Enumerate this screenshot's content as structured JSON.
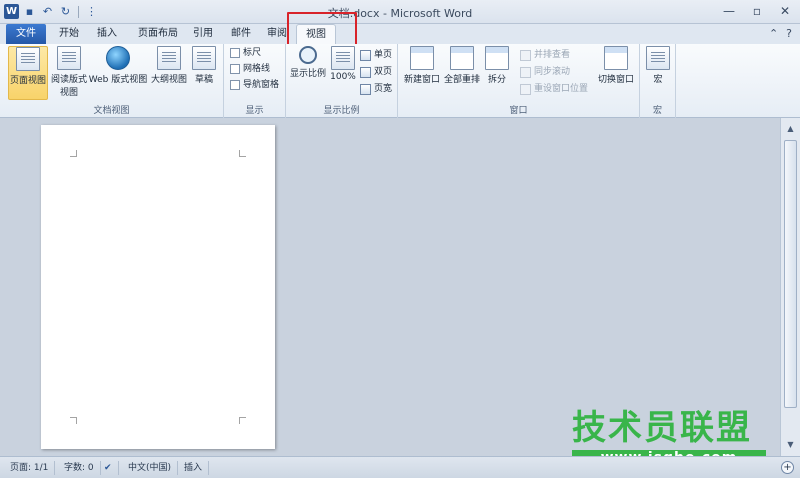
{
  "window": {
    "title": "文档.docx - Microsoft Word",
    "min_glyph": "—",
    "max_glyph": "▫",
    "close_glyph": "✕"
  },
  "qat": {
    "word_glyph": "W",
    "save_glyph": "▪",
    "undo_glyph": "↶",
    "redo_glyph": "↻",
    "customize_glyph": "⋮"
  },
  "tabs": [
    {
      "label": "文件"
    },
    {
      "label": "开始"
    },
    {
      "label": "插入"
    },
    {
      "label": "页面布局"
    },
    {
      "label": "引用"
    },
    {
      "label": "邮件"
    },
    {
      "label": "审阅"
    },
    {
      "label": "视图"
    }
  ],
  "tab_right": {
    "help_glyph": "?",
    "collapse_glyph": "⌃"
  },
  "ribbon": {
    "doc_views": {
      "label": "文档视图",
      "items": [
        "页面视图",
        "阅读版式视图",
        "Web 版式视图",
        "大纲视图",
        "草稿"
      ]
    },
    "show": {
      "label": "显示",
      "items": [
        "标尺",
        "网格线",
        "导航窗格"
      ]
    },
    "zoom": {
      "label": "显示比例",
      "zoom_btn": "显示比例",
      "hundred": "100%",
      "one_page": "单页",
      "two_pages": "双页",
      "page_width": "页宽"
    },
    "window": {
      "label": "窗口",
      "new_window": "新建窗口",
      "arrange_all": "全部重排",
      "split": "拆分",
      "side_by_side": "并排查看",
      "sync_scroll": "同步滚动",
      "reset_position": "重设窗口位置",
      "switch_windows": "切换窗口"
    },
    "macros": {
      "label": "宏",
      "macro_btn": "宏"
    }
  },
  "statusbar": {
    "page": "页面: 1/1",
    "words": "字数: 0",
    "lang": "中文(中国)",
    "insert": "插入",
    "proof_glyph": "✔"
  },
  "scroll": {
    "up": "▲",
    "down": "▼"
  },
  "watermark": {
    "cn": "技术员联盟",
    "url": "www.jsgho.com"
  }
}
